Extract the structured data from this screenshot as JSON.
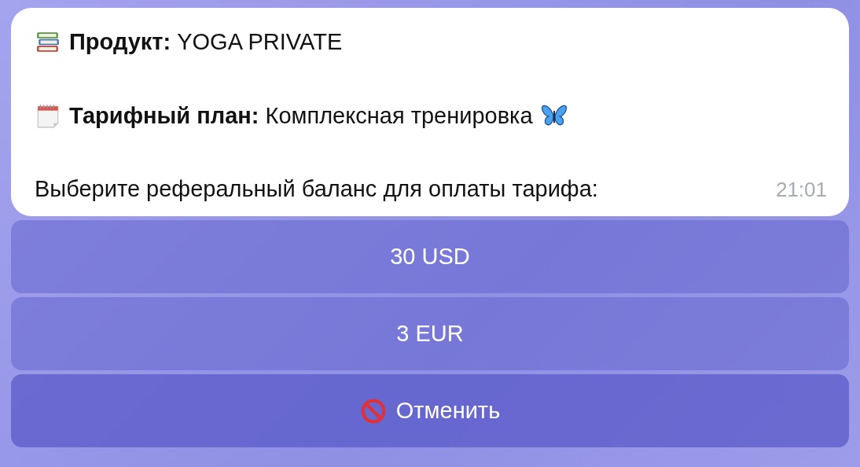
{
  "message": {
    "lines": [
      {
        "text": "**Продукт:** YOGA PRIVATE",
        "trailing_icon": false
      },
      {
        "text": "**Тарифный план:** Комплексная тренировка",
        "trailing_icon": true
      }
    ],
    "prompt": "Выберите реферальный баланс для оплаты тарифа:",
    "time": "21:01"
  },
  "buttons": [
    {
      "kind": "option",
      "label": "30 USD"
    },
    {
      "kind": "option",
      "label": "3 EUR"
    },
    {
      "kind": "cancel",
      "label": "Отменить"
    }
  ]
}
